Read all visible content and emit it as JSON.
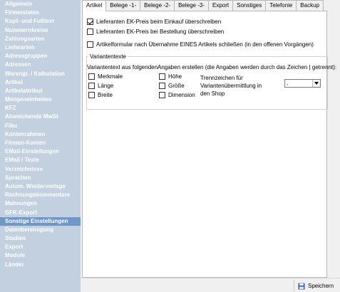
{
  "sidebar": {
    "items": [
      {
        "label": "Allgemein",
        "active": false
      },
      {
        "label": "Firmendaten",
        "active": false
      },
      {
        "label": "Kopf- und Fußtext",
        "active": false
      },
      {
        "label": "Nummernkreise",
        "active": false
      },
      {
        "label": "Zahlungsarten",
        "active": false
      },
      {
        "label": "Lieferarten",
        "active": false
      },
      {
        "label": "Adressgruppen",
        "active": false
      },
      {
        "label": "Adressen",
        "active": false
      },
      {
        "label": "Warengr. / Kalkulation",
        "active": false
      },
      {
        "label": "Artikel",
        "active": false
      },
      {
        "label": "Artikelattribut",
        "active": false
      },
      {
        "label": "Mengeneinheiten",
        "active": false
      },
      {
        "label": "KFZ",
        "active": false
      },
      {
        "label": "Abweichende MwSt",
        "active": false
      },
      {
        "label": "Fibu",
        "active": false
      },
      {
        "label": "Kontenrahmen",
        "active": false
      },
      {
        "label": "Firmen-Konten",
        "active": false
      },
      {
        "label": "EMail-Einstellungen",
        "active": false
      },
      {
        "label": "EMail / Texte",
        "active": false
      },
      {
        "label": "Verzeichnisse",
        "active": false
      },
      {
        "label": "Sprachen",
        "active": false
      },
      {
        "label": "Autom. Wiedervorlage",
        "active": false
      },
      {
        "label": "Rechnungskommentare",
        "active": false
      },
      {
        "label": "Mahnungen",
        "active": false
      },
      {
        "label": "GFK-Export",
        "active": false
      },
      {
        "label": "Sonstige Einstellungen",
        "active": true
      },
      {
        "label": "Datenbereinigung",
        "active": false
      },
      {
        "label": "Stadien",
        "active": false
      },
      {
        "label": "Export",
        "active": false
      },
      {
        "label": "Module",
        "active": false
      },
      {
        "label": "Länder",
        "active": false
      }
    ]
  },
  "tabs": [
    {
      "label": "Artikel",
      "active": true
    },
    {
      "label": "Belege -1-",
      "active": false
    },
    {
      "label": "Belege -2-",
      "active": false
    },
    {
      "label": "Belege -3-",
      "active": false
    },
    {
      "label": "Export",
      "active": false
    },
    {
      "label": "Sonstiges",
      "active": false
    },
    {
      "label": "Telefonie",
      "active": false
    },
    {
      "label": "Backup",
      "active": false
    }
  ],
  "options": {
    "ek_preis_einkauf": {
      "label": "Lieferanten EK-Preis beim Einkauf überschreiben",
      "checked": true
    },
    "ek_preis_bestellung": {
      "label": "Lieferanten EK-Preis bei Bestellung überschreiben",
      "checked": false
    },
    "artikelformular_schliessen": {
      "label": "Artikelformular nach Übernahme EINES Artikels schließen (in den offenen Vorgängen)",
      "checked": false
    }
  },
  "variantentexte": {
    "title": "Variantentexte",
    "col1_label": "Variantentext aus folgenden",
    "col2_label": "Angaben erstellen (die Angaben werden durch das Zeichen | getrennt):",
    "col1_items": [
      {
        "label": "Merkmale",
        "checked": false
      },
      {
        "label": "Länge",
        "checked": false
      },
      {
        "label": "Breite",
        "checked": false
      }
    ],
    "col2_items": [
      {
        "label": "Höhe",
        "checked": false
      },
      {
        "label": "Größe",
        "checked": false
      },
      {
        "label": "Dimension",
        "checked": false
      }
    ],
    "separator_label_line1": "Trennzeichen für",
    "separator_label_line2": "Variantenübermittlung in",
    "separator_label_line3": "den Shop",
    "separator_value": ","
  },
  "footer": {
    "save_label": "Speichern"
  },
  "colors": {
    "sidebar_bg": "#c3d0e0",
    "sidebar_active": "#6f97c9",
    "save_icon": "#2e5fa6"
  },
  "icons": {
    "save": "floppy-disk-icon",
    "dropdown": "chevron-down-icon"
  }
}
